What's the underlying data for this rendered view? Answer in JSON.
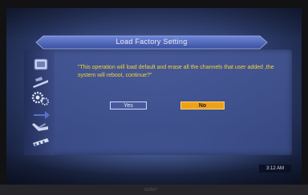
{
  "dialog": {
    "title": "Load Factory Setting",
    "message": "\"This operation will load default and erase all the channels that user added ,the system will reboot, continue?\"",
    "yes_label": "Yes",
    "no_label": "No",
    "selected": "No"
  },
  "sidebar": {
    "icons": [
      "settings-icon",
      "satellite-dish-icon",
      "gears-icon",
      "signal-icon",
      "antenna-icon",
      "film-icon"
    ]
  },
  "status": {
    "clock": "3:12 AM"
  },
  "colors": {
    "message_text": "#f2d23a",
    "selected_button": "#f0a018",
    "screen_bg": "#34457a"
  }
}
